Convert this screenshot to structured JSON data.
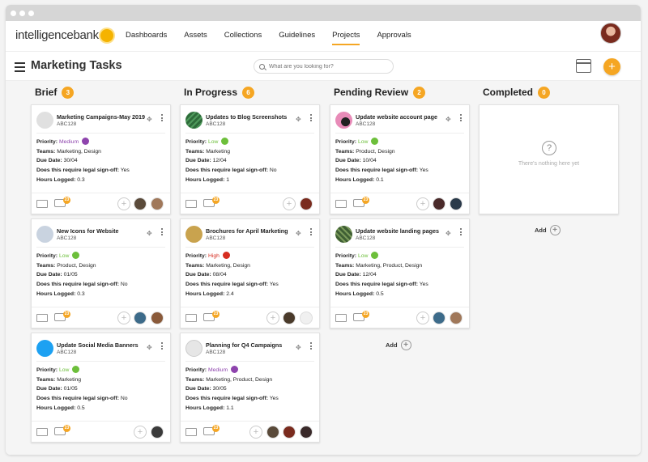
{
  "nav": {
    "logo": "intelligencebank",
    "links": [
      {
        "label": "Dashboards"
      },
      {
        "label": "Assets"
      },
      {
        "label": "Collections"
      },
      {
        "label": "Guidelines"
      },
      {
        "label": "Projects",
        "active": true
      },
      {
        "label": "Approvals"
      }
    ]
  },
  "header": {
    "title": "Marketing Tasks",
    "search_placeholder": "What are you looking for?",
    "add_label": "+"
  },
  "colors": {
    "accent": "#f5a623",
    "low": "#6dbf3b",
    "medium": "#8e44ad",
    "high": "#d62d20"
  },
  "field_labels": {
    "priority": "Priority:",
    "teams": "Teams:",
    "due": "Due Date:",
    "legal": "Does this require legal sign-off:",
    "hours": "Hours Logged:"
  },
  "columns": [
    {
      "title": "Brief",
      "count": "3",
      "cards": [
        {
          "title": "Marketing Campaigns-May 2019",
          "code": "ABC128",
          "priority": "Medium",
          "teams": "Marketing, Design",
          "due": "30/04",
          "legal": "Yes",
          "hours": "0.3",
          "comments": "23",
          "thumb": "#d9d9d9"
        },
        {
          "title": "New Icons for Website",
          "code": "ABC128",
          "priority": "Low",
          "teams": "Product, Design",
          "due": "01/05",
          "legal": "No",
          "hours": "0.3",
          "comments": "23",
          "thumb": "#c9d3e0"
        },
        {
          "title": "Update Social Media Banners",
          "code": "ABC128",
          "priority": "Low",
          "teams": "Marketing",
          "due": "01/05",
          "legal": "No",
          "hours": "0.5",
          "comments": "23",
          "thumb": "#1da1f2"
        }
      ]
    },
    {
      "title": "In Progress",
      "count": "6",
      "cards": [
        {
          "title": "Updates to Blog Screenshots",
          "code": "ABC128",
          "priority": "Low",
          "teams": "Marketing",
          "due": "12/04",
          "legal": "No",
          "hours": "1",
          "comments": "23",
          "thumb": "#2e6b3a"
        },
        {
          "title": "Brochures for April Marketing",
          "code": "ABC128",
          "priority": "High",
          "teams": "Marketing, Design",
          "due": "08/04",
          "legal": "Yes",
          "hours": "2.4",
          "comments": "23",
          "thumb": "#c9a34e"
        },
        {
          "title": "Planning for Q4 Campaigns",
          "code": "ABC128",
          "priority": "Medium",
          "teams": "Marketing, Product, Design",
          "due": "30/05",
          "legal": "Yes",
          "hours": "1.1",
          "comments": "23",
          "thumb": "#e6e6e6"
        }
      ]
    },
    {
      "title": "Pending Review",
      "count": "2",
      "cards": [
        {
          "title": "Update website account page",
          "code": "ABC128",
          "priority": "Low",
          "teams": "Product, Design",
          "due": "10/04",
          "legal": "Yes",
          "hours": "0.1",
          "comments": "23",
          "thumb": "#e88bb8"
        },
        {
          "title": "Update website landing pages",
          "code": "ABC128",
          "priority": "Low",
          "teams": "Marketing, Product, Design",
          "due": "12/04",
          "legal": "Yes",
          "hours": "0.5",
          "comments": "23",
          "thumb": "#3f5f34"
        }
      ],
      "add_label": "Add"
    },
    {
      "title": "Completed",
      "count": "0",
      "empty_text": "There's nothing here yet",
      "add_label": "Add"
    }
  ]
}
